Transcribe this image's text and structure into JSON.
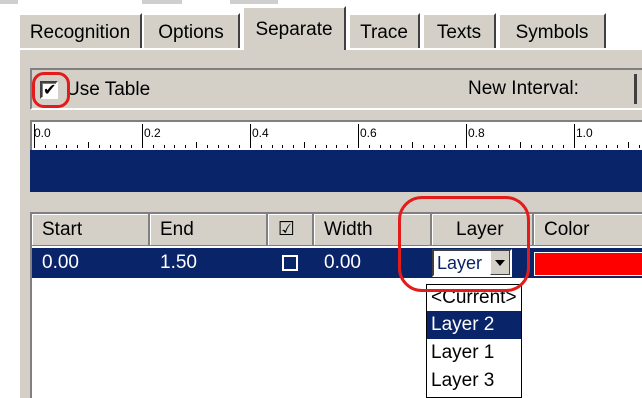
{
  "tabs": [
    "Recognition",
    "Options",
    "Separate",
    "Trace",
    "Texts",
    "Symbols"
  ],
  "active_tab": "Separate",
  "use_table": {
    "label": "Use Table",
    "checked": true
  },
  "new_interval": {
    "label": "New Interval:"
  },
  "ruler": {
    "labels": [
      "0.0",
      "0.2",
      "0.4",
      "0.6",
      "0.8",
      "1.0"
    ]
  },
  "table": {
    "headers": {
      "start": "Start",
      "end": "End",
      "check": "☑",
      "width": "Width",
      "layer": "Layer",
      "color": "Color"
    },
    "row": {
      "start": "0.00",
      "end": "1.50",
      "width": "0.00",
      "layer": "Layer",
      "color": "#ff0000"
    }
  },
  "dropdown": {
    "options": [
      "<Current>",
      "Layer 2",
      "Layer 1",
      "Layer 3"
    ],
    "selected": "Layer 2"
  },
  "colors": {
    "selection": "#0a246a",
    "annotation": "#e31b1b",
    "swatch": "#ff0000",
    "panel": "#d4d0c8"
  }
}
